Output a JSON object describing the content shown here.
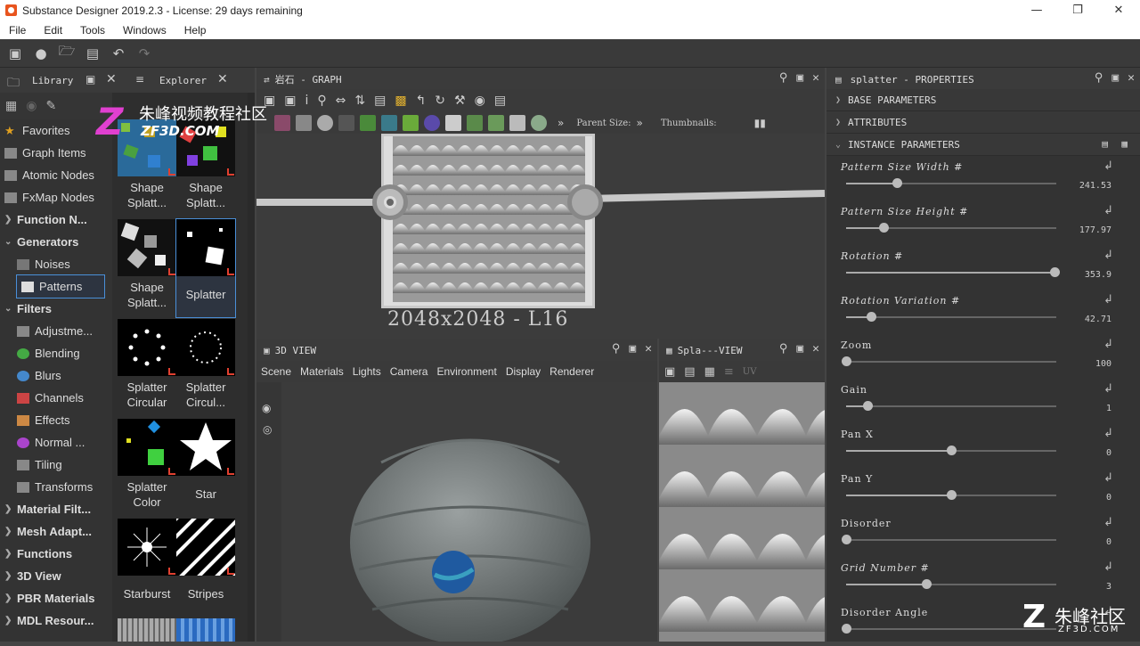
{
  "window": {
    "title": "Substance Designer 2019.2.3 - License: 29 days remaining"
  },
  "menu": [
    "File",
    "Edit",
    "Tools",
    "Windows",
    "Help"
  ],
  "library": {
    "tab_library": "Library",
    "tab_explorer": "Explorer",
    "tree": [
      {
        "label": "Favorites",
        "icon": "star-icon",
        "bold": false,
        "child": false
      },
      {
        "label": "Graph Items",
        "icon": "graph-items-icon",
        "bold": false,
        "child": false
      },
      {
        "label": "Atomic Nodes",
        "icon": "atomic-nodes-icon",
        "bold": false,
        "child": false
      },
      {
        "label": "FxMap Nodes",
        "icon": "fxmap-icon",
        "bold": false,
        "child": false
      },
      {
        "label": "Function N...",
        "icon": "arrow",
        "bold": true,
        "child": false
      },
      {
        "label": "Generators",
        "icon": "arrow-open",
        "bold": true,
        "child": false
      },
      {
        "label": "Noises",
        "icon": "noises-icon",
        "bold": false,
        "child": true
      },
      {
        "label": "Patterns",
        "icon": "patterns-icon",
        "bold": false,
        "child": true,
        "selected": true
      },
      {
        "label": "Filters",
        "icon": "arrow-open",
        "bold": true,
        "child": false
      },
      {
        "label": "Adjustme...",
        "icon": "adjustments-icon",
        "bold": false,
        "child": true
      },
      {
        "label": "Blending",
        "icon": "blending-icon",
        "bold": false,
        "child": true
      },
      {
        "label": "Blurs",
        "icon": "blurs-icon",
        "bold": false,
        "child": true
      },
      {
        "label": "Channels",
        "icon": "channels-icon",
        "bold": false,
        "child": true
      },
      {
        "label": "Effects",
        "icon": "effects-icon",
        "bold": false,
        "child": true
      },
      {
        "label": "Normal ...",
        "icon": "normal-icon",
        "bold": false,
        "child": true
      },
      {
        "label": "Tiling",
        "icon": "tiling-icon",
        "bold": false,
        "child": true
      },
      {
        "label": "Transforms",
        "icon": "transforms-icon",
        "bold": false,
        "child": true
      },
      {
        "label": "Material Filt...",
        "icon": "arrow",
        "bold": true,
        "child": false
      },
      {
        "label": "Mesh Adapt...",
        "icon": "arrow",
        "bold": true,
        "child": false
      },
      {
        "label": "Functions",
        "icon": "arrow",
        "bold": true,
        "child": false
      },
      {
        "label": "3D View",
        "icon": "arrow",
        "bold": true,
        "child": false
      },
      {
        "label": "PBR Materials",
        "icon": "arrow",
        "bold": true,
        "child": false
      },
      {
        "label": "MDL Resour...",
        "icon": "arrow",
        "bold": true,
        "child": false
      }
    ],
    "thumbs": [
      {
        "l1": "Shape",
        "l2": "Splatt..."
      },
      {
        "l1": "Shape",
        "l2": "Splatt..."
      },
      {
        "l1": "Shape",
        "l2": "Splatt..."
      },
      {
        "l1": "Splatter",
        "l2": ""
      },
      {
        "l1": "Splatter",
        "l2": "Circular"
      },
      {
        "l1": "Splatter",
        "l2": "Circul..."
      },
      {
        "l1": "Splatter",
        "l2": "Color"
      },
      {
        "l1": "Star",
        "l2": ""
      },
      {
        "l1": "Starburst",
        "l2": ""
      },
      {
        "l1": "Stripes",
        "l2": ""
      }
    ]
  },
  "graph": {
    "title": "岩石 - GRAPH",
    "parent_size_label": "Parent Size:",
    "thumbnails_label": "Thumbnails:",
    "node_resolution": "2048x2048 - L16"
  },
  "view3d": {
    "title": "3D VIEW",
    "menu": [
      "Scene",
      "Materials",
      "Lights",
      "Camera",
      "Environment",
      "Display",
      "Renderer"
    ]
  },
  "view2d": {
    "title": "Spla---VIEW",
    "uv_label": "UV"
  },
  "properties": {
    "title": "splatter - PROPERTIES",
    "sections": [
      "BASE PARAMETERS",
      "ATTRIBUTES",
      "INSTANCE PARAMETERS"
    ],
    "params": [
      {
        "label": "Pattern Size Width #",
        "value": "241.53",
        "pos": 0.24,
        "italic": true
      },
      {
        "label": "Pattern Size Height #",
        "value": "177.97",
        "pos": 0.18,
        "italic": true
      },
      {
        "label": "Rotation #",
        "value": "353.9",
        "pos": 0.99,
        "italic": true
      },
      {
        "label": "Rotation Variation #",
        "value": "42.71",
        "pos": 0.12,
        "italic": true
      },
      {
        "label": "Zoom",
        "value": "100",
        "pos": 0.0,
        "italic": false
      },
      {
        "label": "Gain",
        "value": "1",
        "pos": 0.1,
        "italic": false
      },
      {
        "label": "Pan X",
        "value": "0",
        "pos": 0.5,
        "italic": false
      },
      {
        "label": "Pan Y",
        "value": "0",
        "pos": 0.5,
        "italic": false
      },
      {
        "label": "Disorder",
        "value": "0",
        "pos": 0.0,
        "italic": false
      },
      {
        "label": "Grid Number #",
        "value": "3",
        "pos": 0.38,
        "italic": true
      },
      {
        "label": "Disorder Angle",
        "value": "",
        "pos": 0.0,
        "italic": false
      }
    ]
  },
  "watermarks": {
    "top_cn": "朱峰视频教程社区",
    "top_en": "ZF3D.COM",
    "bottom_cn": "朱峰社区",
    "bottom_en": "ZF3D.COM"
  },
  "colors": {
    "accent": "#4a8fd8",
    "tag": "#e04030"
  }
}
